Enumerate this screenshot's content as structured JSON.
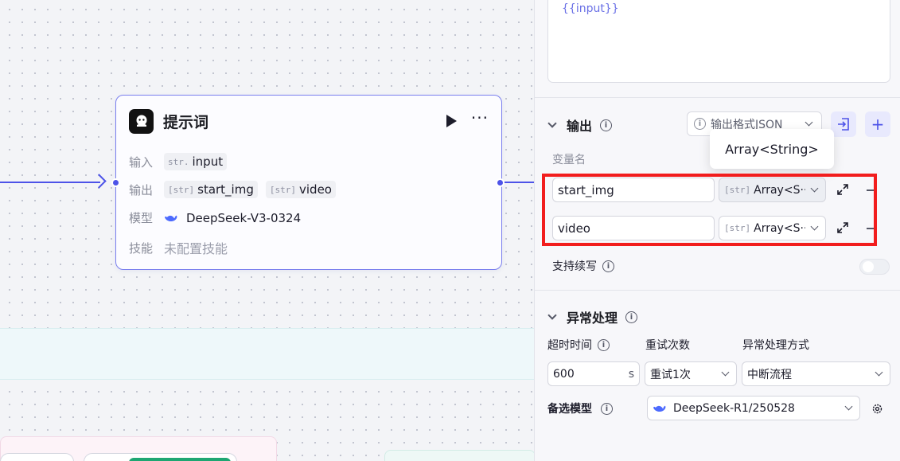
{
  "node": {
    "title": "提示词",
    "input_label": "输入",
    "input_var": "input",
    "output_label": "输出",
    "outputs": [
      "start_img",
      "video"
    ],
    "model_label": "模型",
    "model_name": "DeepSeek-V3-0324",
    "skill_label": "技能",
    "skill_value": "未配置技能",
    "type_prefix": "str."
  },
  "panel": {
    "prompt_text": "{{input}}",
    "output_section": {
      "title": "输出",
      "format_label": "输出格式JSON",
      "column_label": "变量名",
      "tooltip": "Array<String>",
      "rows": [
        {
          "name": "start_img",
          "type": "Array<S···"
        },
        {
          "name": "video",
          "type": "Array<S···"
        }
      ],
      "type_prefix": "[str]",
      "streaming_label": "支持续写"
    },
    "exception_section": {
      "title": "异常处理",
      "timeout_label": "超时时间",
      "retry_label": "重试次数",
      "mode_label": "异常处理方式",
      "timeout_value": "600",
      "timeout_unit": "s",
      "retry_value": "重试1次",
      "mode_value": "中断流程",
      "backup_label": "备选模型",
      "backup_model": "DeepSeek-R1/250528"
    }
  },
  "colors": {
    "accent": "#4d53e8",
    "highlight_box": "#f21d1d"
  }
}
